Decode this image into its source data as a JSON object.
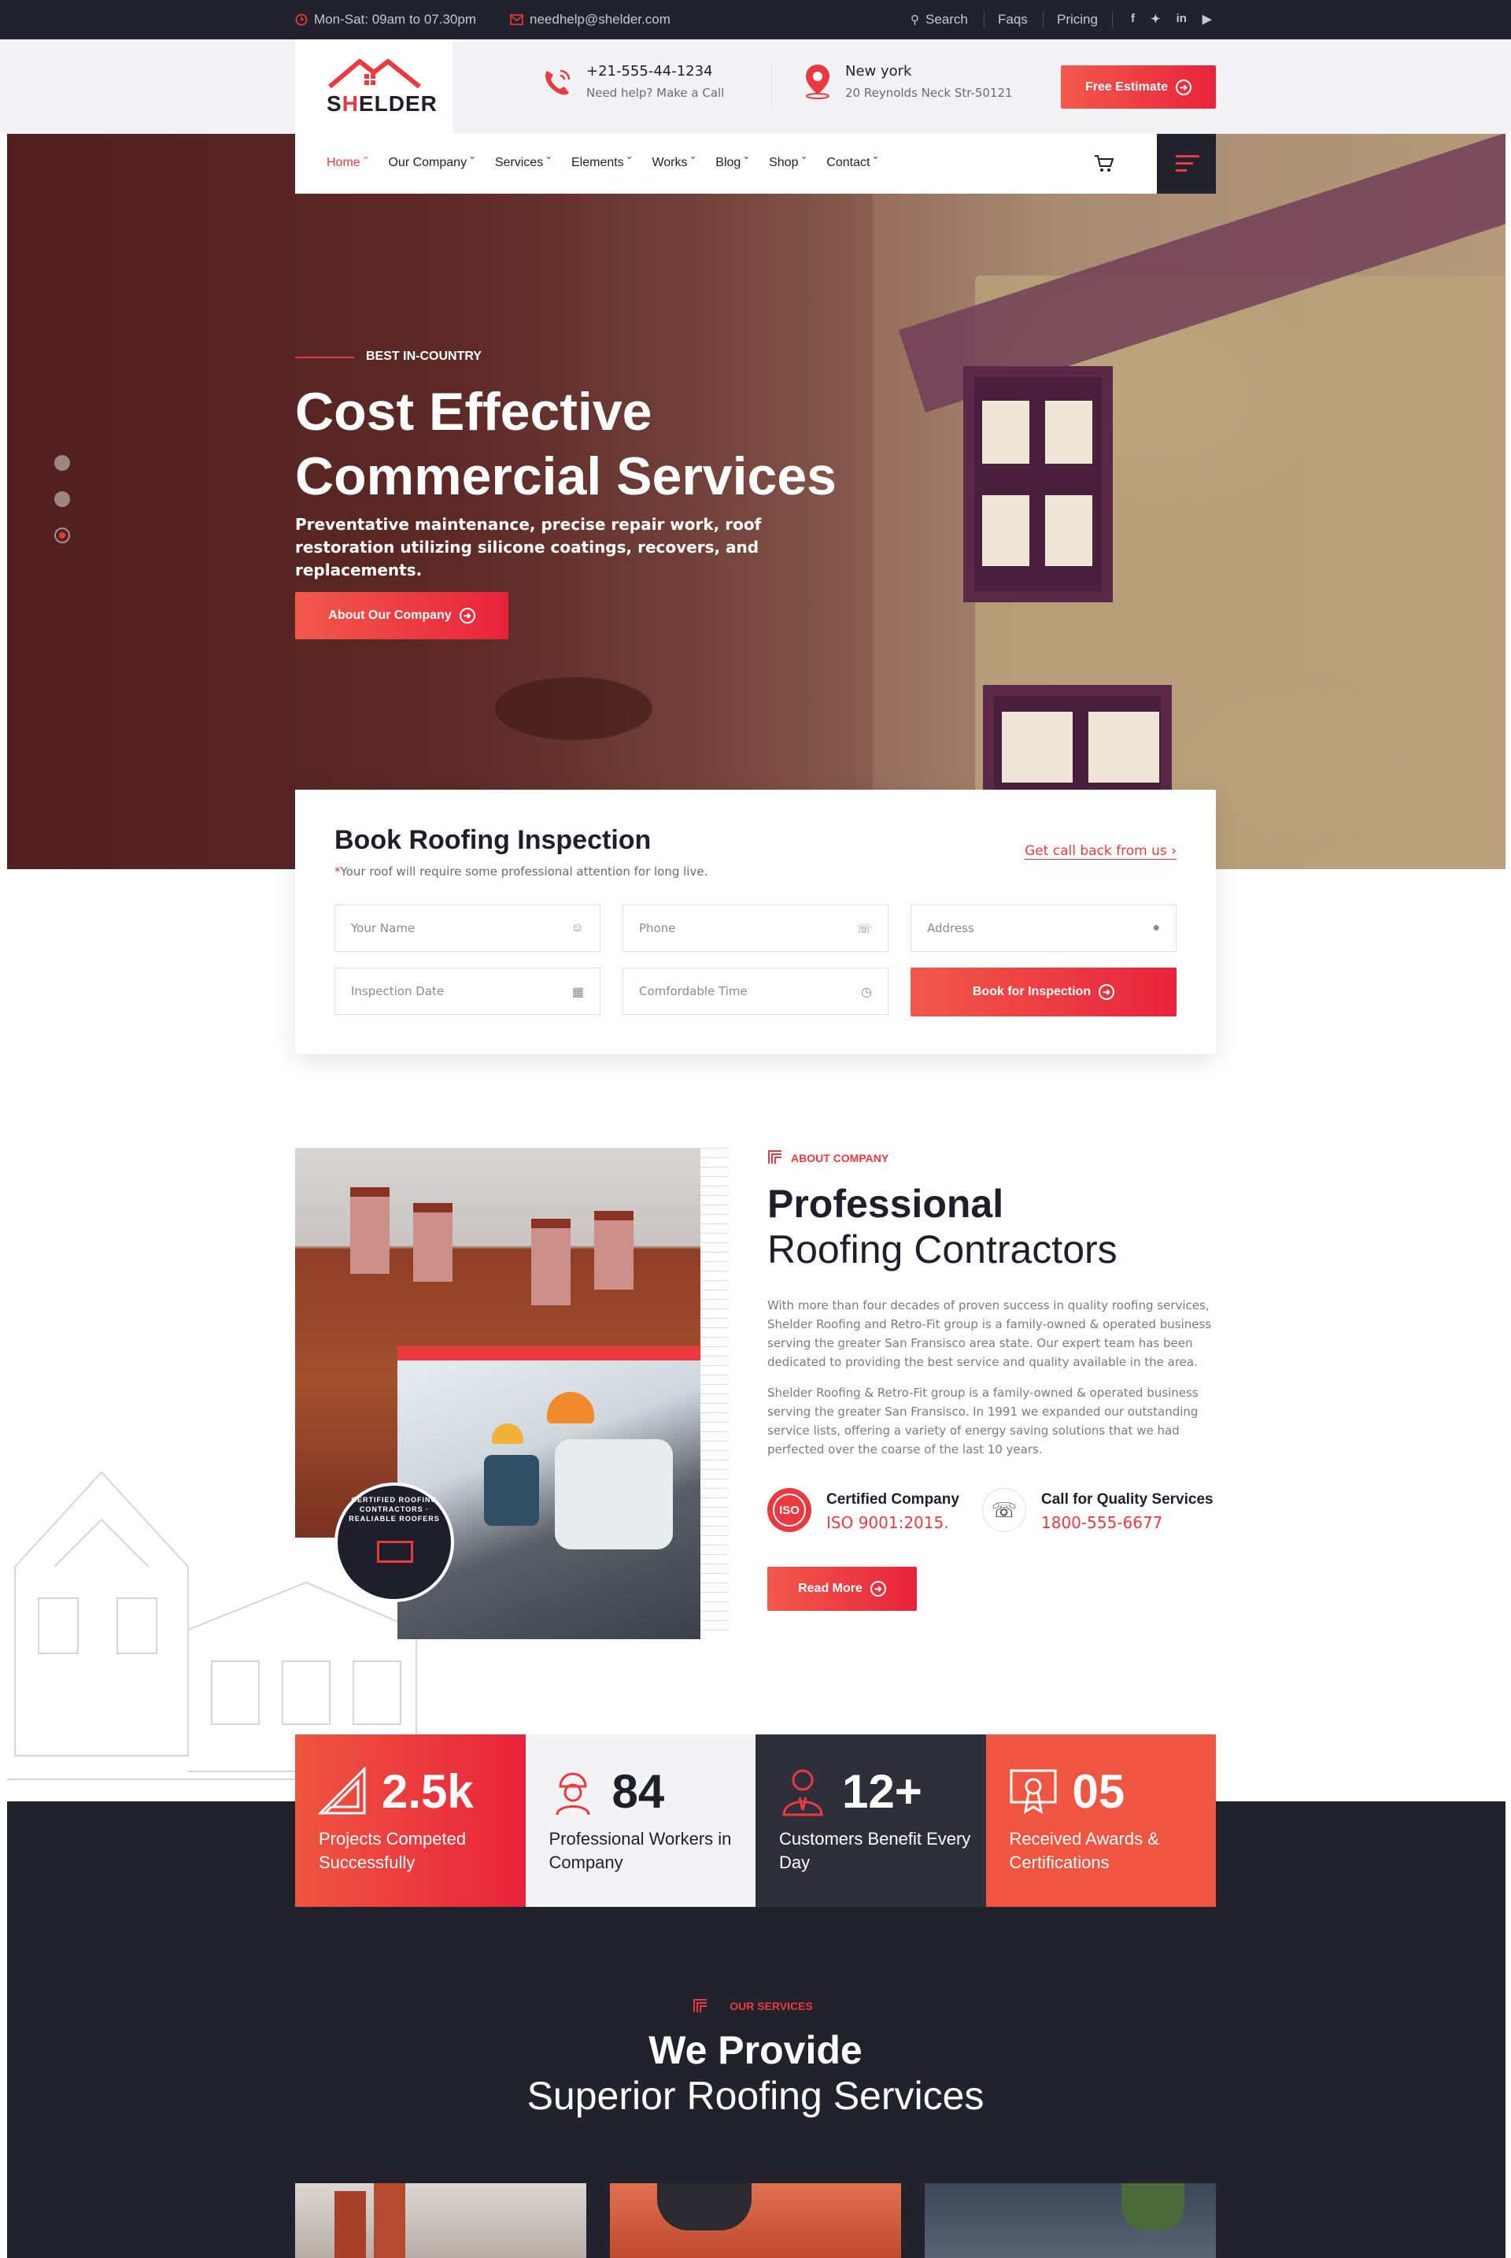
{
  "topbar": {
    "hours": "Mon-Sat: 09am to 07.30pm",
    "email": "needhelp@shelder.com",
    "links": [
      "Search",
      "Faqs",
      "Pricing"
    ],
    "social": [
      "f",
      "t",
      "in",
      "yt"
    ]
  },
  "header": {
    "logo": {
      "prefix": "S",
      "accent": "H",
      "rest": "ELDER"
    },
    "phone": {
      "number": "+21-555-44-1234",
      "caption": "Need help? Make a Call"
    },
    "location": {
      "city": "New york",
      "address": "20 Reynolds Neck Str-50121"
    },
    "cta": "Free Estimate"
  },
  "nav": {
    "items": [
      "Home",
      "Our Company",
      "Services",
      "Elements",
      "Works",
      "Blog",
      "Shop",
      "Contact"
    ]
  },
  "hero": {
    "eyebrow": "BEST IN-COUNTRY",
    "title_line1": "Cost Effective",
    "title_line2": "Commercial Services",
    "subtitle": "Preventative maintenance, precise repair work, roof restoration utilizing silicone coatings, recovers, and replacements.",
    "button": "About Our Company"
  },
  "booking": {
    "title": "Book Roofing Inspection",
    "note_star": "*",
    "note": "Your roof will require some professional attention for long live.",
    "callback_link": "Get call back from us",
    "fields": {
      "name": "Your Name",
      "phone": "Phone",
      "address": "Address",
      "date": "Inspection Date",
      "time": "Comfordable Time"
    },
    "submit": "Book for Inspection"
  },
  "about": {
    "eyebrow": "ABOUT COMPANY",
    "title_bold": "Professional",
    "title_light": "Roofing Contractors",
    "para1": "With more than four decades of proven success in quality roofing services, Shelder Roofing and Retro-Fit group is a family-owned & operated business serving the greater San Fransisco area state. Our expert team has been dedicated to providing the best service and quality available in the area.",
    "para2": "Shelder Roofing & Retro-Fit group is a family-owned & operated business serving the greater San Fransisco. In 1991 we expanded our outstanding service lists, offering a variety of energy saving solutions that we had perfected over the coarse of the last 10 years.",
    "badge_text": "CERTIFIED ROOFING CONTRACTORS · REALIABLE ROOFERS",
    "feature1": {
      "title": "Certified Company",
      "value": "ISO 9001:2015.",
      "icon_label": "ISO"
    },
    "feature2": {
      "title": "Call for Quality Services",
      "value": "1800-555-6677"
    },
    "button": "Read More"
  },
  "stats": [
    {
      "number": "2.5k",
      "label": "Projects Competed Successfully",
      "icon": "ruler-triangle-icon"
    },
    {
      "number": "84",
      "label": "Professional Workers in Company",
      "icon": "worker-icon"
    },
    {
      "number": "12+",
      "label": "Customers Benefit Every Day",
      "icon": "customer-icon"
    },
    {
      "number": "05",
      "label": "Received Awards & Certifications",
      "icon": "certificate-icon"
    }
  ],
  "services": {
    "eyebrow": "OUR SERVICES",
    "title_bold": "We Provide",
    "title_light": "Superior Roofing Services"
  },
  "colors": {
    "accent": "#ea3a3f",
    "dark": "#22222c",
    "stat1": "#e8313f",
    "stat2": "#f3f3f5",
    "stat3": "#2f2f3c",
    "stat4": "#ef5540"
  }
}
